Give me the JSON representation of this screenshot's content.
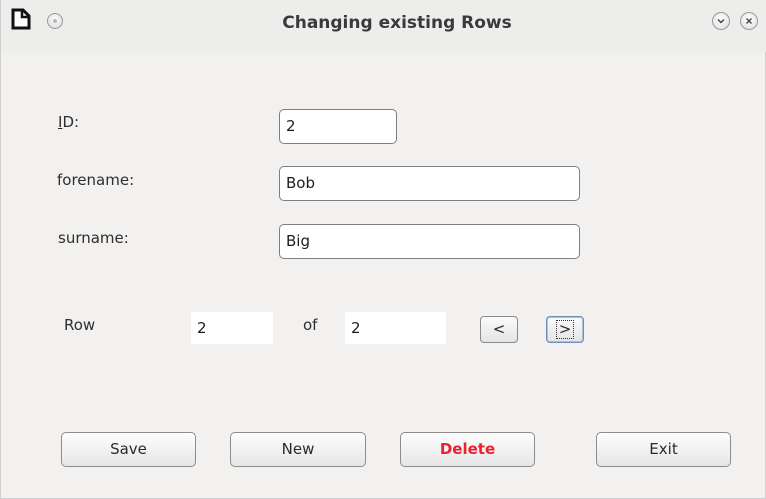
{
  "window": {
    "title": "Changing existing Rows"
  },
  "form": {
    "id": {
      "label": "ID:",
      "value": "2"
    },
    "forename": {
      "label": "forename:",
      "value": "Bob"
    },
    "surname": {
      "label": "surname:",
      "value": "Big"
    }
  },
  "navigation": {
    "row_label": "Row",
    "current_row": "2",
    "of_label": "of",
    "total_rows": "2",
    "prev_label": "<",
    "next_label": ">"
  },
  "buttons": {
    "save": "Save",
    "new": "New",
    "delete": "Delete",
    "exit": "Exit"
  },
  "colors": {
    "delete_text": "#e8232f",
    "background": "#f2f1f0"
  },
  "icons": {
    "app": "document-icon",
    "menu": "window-menu-icon",
    "minimize": "chevron-down-icon",
    "close": "close-icon"
  }
}
